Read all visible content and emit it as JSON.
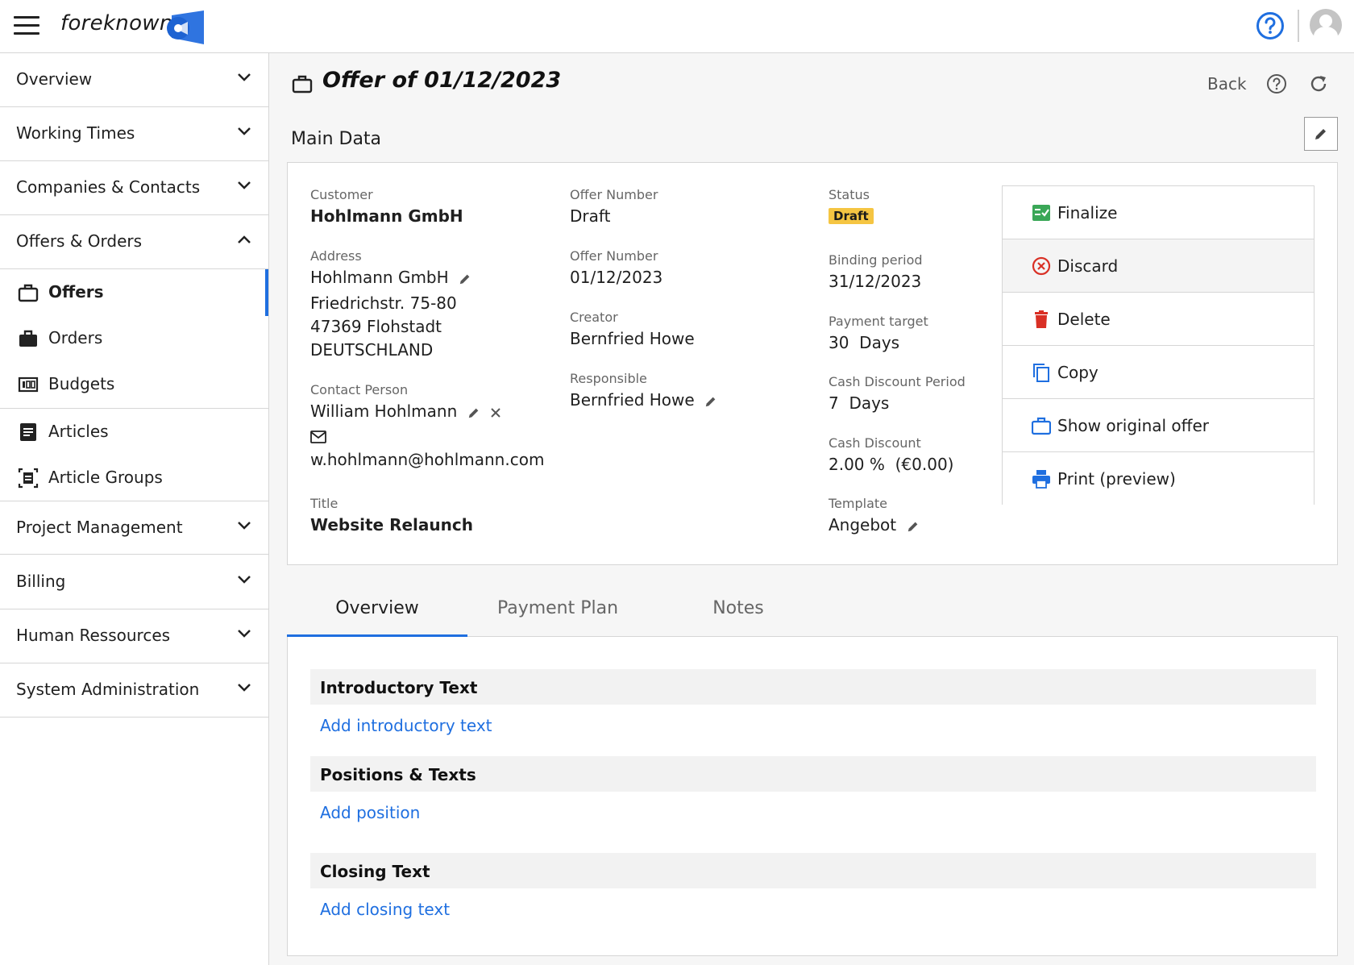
{
  "app": {
    "brand": "foreknown"
  },
  "sidebar": {
    "groups": [
      {
        "label": "Overview"
      },
      {
        "label": "Working Times"
      },
      {
        "label": "Companies & Contacts"
      },
      {
        "label": "Offers & Orders"
      },
      {
        "label": "Project Management"
      },
      {
        "label": "Billing"
      },
      {
        "label": "Human Ressources"
      },
      {
        "label": "System Administration"
      }
    ],
    "sub_items": [
      {
        "label": "Offers"
      },
      {
        "label": "Orders"
      },
      {
        "label": "Budgets"
      },
      {
        "label": "Articles"
      },
      {
        "label": "Article Groups"
      }
    ]
  },
  "header": {
    "title": "Offer of 01/12/2023",
    "back_label": "Back"
  },
  "main_data": {
    "section_title": "Main Data",
    "customer_label": "Customer",
    "customer": "Hohlmann GmbH",
    "address_label": "Address",
    "address_name": "Hohlmann GmbH",
    "address_street": "Friedrichstr. 75-80",
    "address_city": "47369 Flohstadt",
    "address_country": "DEUTSCHLAND",
    "contact_label": "Contact Person",
    "contact_name": "William Hohlmann",
    "contact_email": "w.hohlmann@hohlmann.com",
    "title_label": "Title",
    "title_value": "Website Relaunch",
    "offer_number_label": "Offer Number",
    "offer_number": "Draft",
    "offer_date_label": "Offer Number",
    "offer_date": "01/12/2023",
    "creator_label": "Creator",
    "creator": "Bernfried Howe",
    "responsible_label": "Responsible",
    "responsible": "Bernfried Howe",
    "status_label": "Status",
    "status": "Draft",
    "binding_label": "Binding period",
    "binding": "31/12/2023",
    "payment_target_label": "Payment target",
    "payment_target": "30  Days",
    "cash_period_label": "Cash Discount Period",
    "cash_period": "7  Days",
    "cash_discount_label": "Cash Discount",
    "cash_discount": "2.00 %  (€0.00)",
    "template_label": "Template",
    "template": "Angebot"
  },
  "actions": [
    {
      "label": "Finalize"
    },
    {
      "label": "Discard"
    },
    {
      "label": "Delete"
    },
    {
      "label": "Copy"
    },
    {
      "label": "Show original offer"
    },
    {
      "label": "Print (preview)"
    }
  ],
  "tabs": [
    {
      "label": "Overview"
    },
    {
      "label": "Payment Plan"
    },
    {
      "label": "Notes"
    }
  ],
  "overview": {
    "intro_title": "Introductory Text",
    "intro_link": "Add introductory text",
    "positions_title": "Positions & Texts",
    "positions_link": "Add position",
    "closing_title": "Closing Text",
    "closing_link": "Add closing text"
  },
  "colors": {
    "accent": "#1f6fe0",
    "status_draft": "#f5c542",
    "finalize_green": "#3aa757",
    "danger_red": "#d93025"
  }
}
